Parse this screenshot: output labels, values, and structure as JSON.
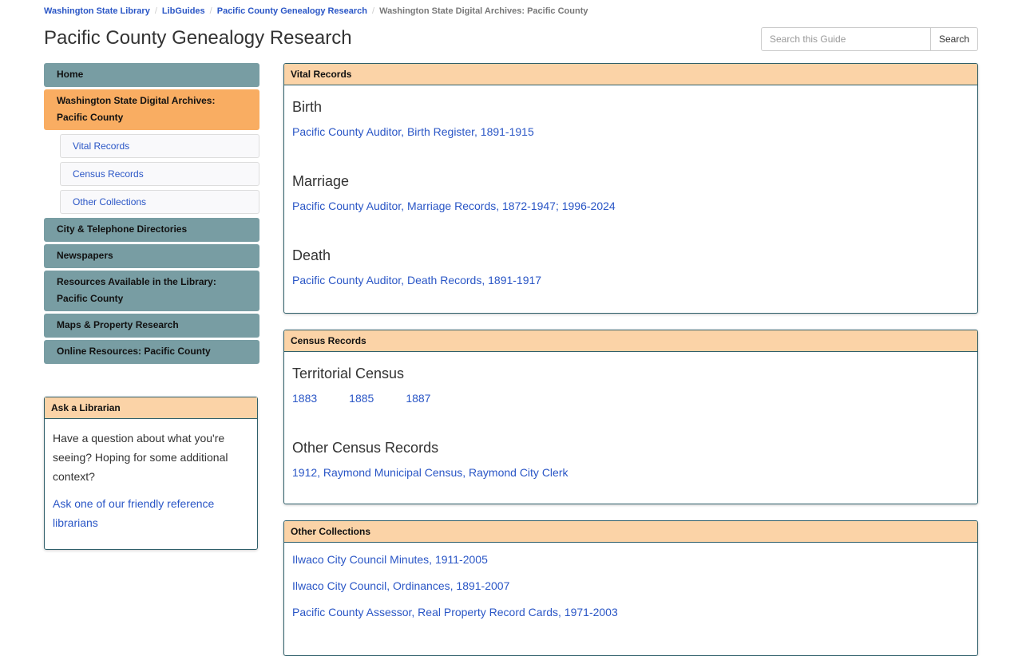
{
  "breadcrumb": [
    "Washington State Library",
    "LibGuides",
    "Pacific County Genealogy Research",
    "Washington State Digital Archives: Pacific County"
  ],
  "title": "Pacific County Genealogy Research",
  "search": {
    "placeholder": "Search this Guide",
    "button": "Search"
  },
  "nav": {
    "home": "Home",
    "active": "Washington State Digital Archives: Pacific County",
    "subs": [
      "Vital Records",
      "Census Records",
      "Other Collections"
    ],
    "items": [
      "City & Telephone Directories",
      "Newspapers",
      "Resources Available in the Library: Pacific County",
      "Maps & Property Research",
      "Online Resources: Pacific County"
    ]
  },
  "ask": {
    "title": "Ask a Librarian",
    "text": "Have a question about what you're seeing? Hoping for some additional context?",
    "link": "Ask one of our friendly reference librarians"
  },
  "vital": {
    "title": "Vital Records",
    "birth": "Birth",
    "birth_link": "Pacific County Auditor, Birth Register, 1891-1915",
    "marriage": "Marriage",
    "marriage_link": "Pacific County Auditor, Marriage Records, 1872-1947; 1996-2024",
    "death": "Death",
    "death_link": "Pacific County Auditor, Death Records, 1891-1917"
  },
  "census": {
    "title": "Census Records",
    "territorial": "Territorial Census",
    "years": [
      "1883",
      "1885",
      "1887"
    ],
    "other": "Other Census Records",
    "other_link": "1912, Raymond Municipal Census, Raymond City Clerk"
  },
  "other": {
    "title": "Other Collections",
    "links": [
      "Ilwaco City Council Minutes, 1911-2005",
      "Ilwaco City Council, Ordinances, 1891-2007",
      "Pacific County Assessor, Real Property Record Cards, 1971-2003"
    ]
  }
}
